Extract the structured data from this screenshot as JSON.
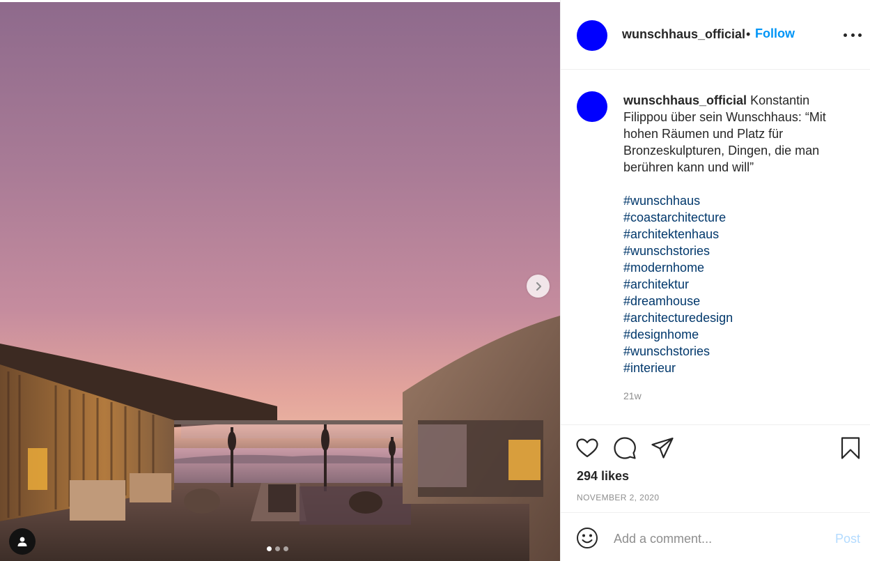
{
  "post": {
    "username": "wunschhaus_official",
    "header_separator": "•",
    "follow_label": "Follow",
    "caption": {
      "username": "wunschhaus_official",
      "text": "Konstantin Filippou über sein Wunschhaus: “Mit hohen Räumen und Platz für Bronzeskulpturen, Dingen, die man berühren kann und will”",
      "hashtags": [
        "#wunschhaus",
        "#coastarchitecture",
        "#architektenhaus",
        "#wunschstories",
        "#modernhome",
        "#architektur",
        "#dreamhouse",
        "#architecturedesign",
        "#designhome",
        "#wunschstories",
        "#interieur"
      ],
      "age": "21w"
    },
    "likes": "294 likes",
    "date": "NOVEMBER 2, 2020",
    "comment": {
      "placeholder": "Add a comment...",
      "value": "",
      "post_label": "Post"
    }
  },
  "media": {
    "slide_count": 3,
    "active_slide": 1,
    "icons": {
      "next": "chevron-right-icon",
      "user_tag": "user-icon",
      "like": "heart-icon",
      "comment": "comment-icon",
      "share": "paper-plane-icon",
      "save": "bookmark-icon",
      "emoji": "smiley-icon",
      "options": "more-horizontal-icon"
    }
  },
  "colors": {
    "avatar": "#0000ff",
    "follow": "#0095f6",
    "hashtag": "#00376b",
    "post_disabled": "#b3dbff",
    "muted": "#8e8e8e"
  }
}
